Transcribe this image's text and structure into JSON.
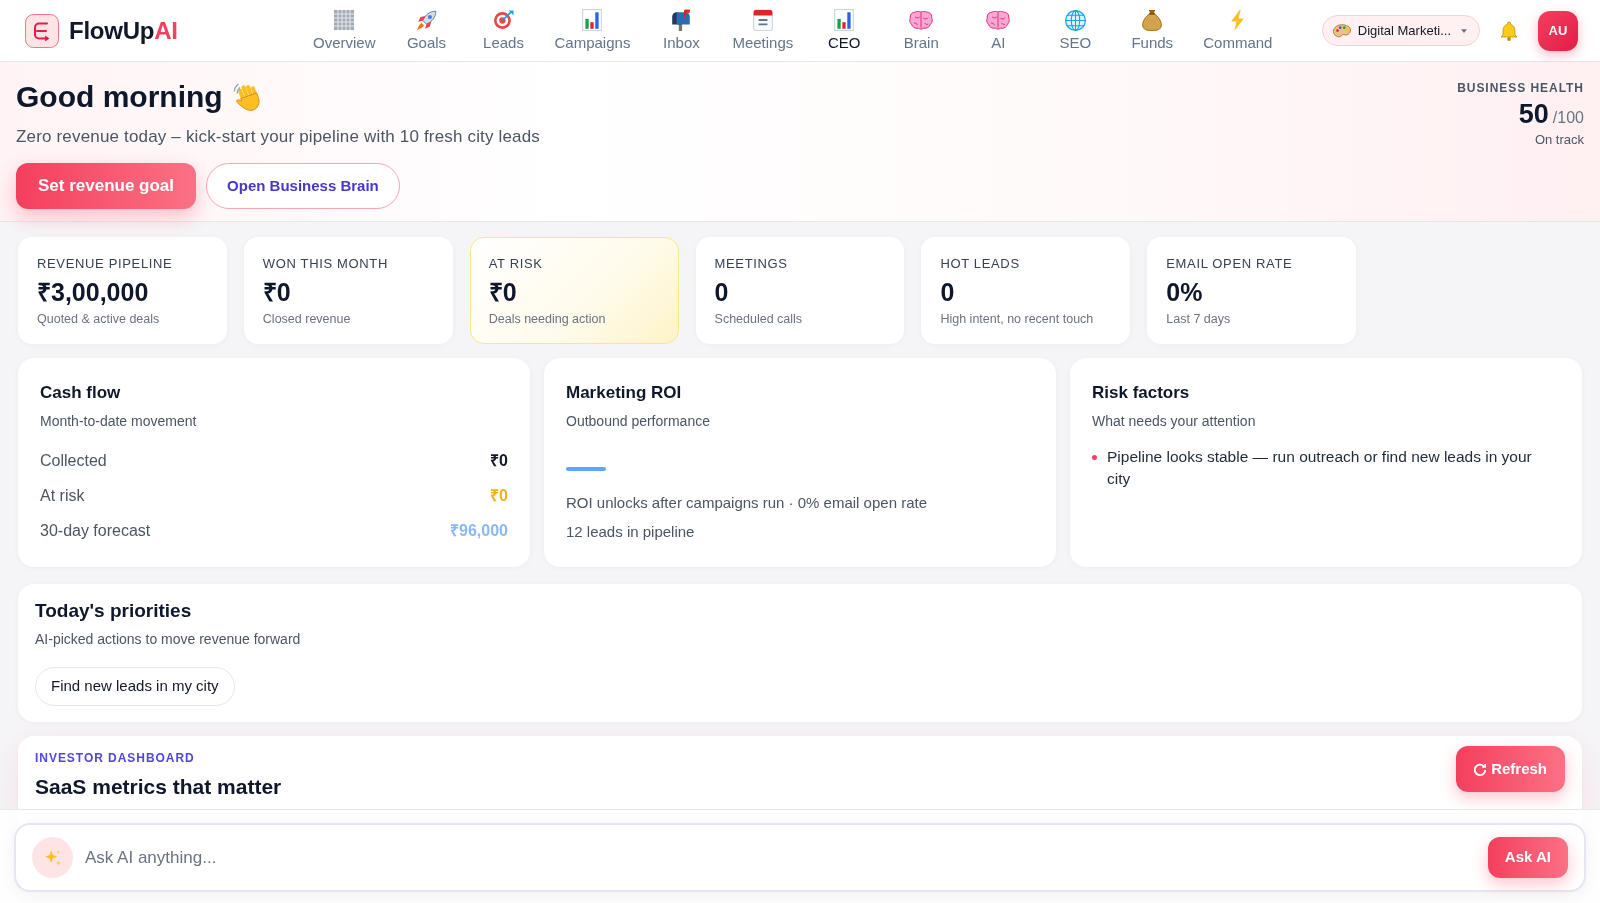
{
  "header": {
    "brand": {
      "name": "FlowUp",
      "accent": "AI"
    },
    "nav": [
      {
        "label": "Overview",
        "selected": false
      },
      {
        "label": "Goals",
        "selected": false
      },
      {
        "label": "Leads",
        "selected": false
      },
      {
        "label": "Campaigns",
        "selected": false
      },
      {
        "label": "Inbox",
        "selected": false
      },
      {
        "label": "Meetings",
        "selected": false
      },
      {
        "label": "CEO",
        "selected": true
      },
      {
        "label": "Brain",
        "selected": false
      },
      {
        "label": "AI",
        "selected": false
      },
      {
        "label": "SEO",
        "selected": false
      },
      {
        "label": "Funds",
        "selected": false
      },
      {
        "label": "Command",
        "selected": false
      }
    ],
    "workspace": {
      "label": "Digital Marketi..."
    },
    "avatar": {
      "initials": "AU"
    }
  },
  "hero": {
    "greeting": "Good morning",
    "subtitle": "Zero revenue today – kick-start your pipeline with 10 fresh city leads",
    "buttons": [
      {
        "label": "Set revenue goal",
        "kind": "primary"
      },
      {
        "label": "Open Business Brain",
        "kind": "outline"
      }
    ],
    "health": {
      "label": "BUSINESS HEALTH",
      "score": "50",
      "max": "/100",
      "status": "On track"
    }
  },
  "stats": [
    {
      "label": "REVENUE PIPELINE",
      "value": "₹3,00,000",
      "note": "Quoted & active deals",
      "highlighted": false
    },
    {
      "label": "WON THIS MONTH",
      "value": "₹0",
      "note": "Closed revenue",
      "highlighted": false
    },
    {
      "label": "AT RISK",
      "value": "₹0",
      "note": "Deals needing action",
      "highlighted": true
    },
    {
      "label": "MEETINGS",
      "value": "0",
      "note": "Scheduled calls",
      "highlighted": false
    },
    {
      "label": "HOT LEADS",
      "value": "0",
      "note": "High intent, no recent touch",
      "highlighted": false
    },
    {
      "label": "EMAIL OPEN RATE",
      "value": "0%",
      "note": "Last 7 days",
      "highlighted": false
    }
  ],
  "cash_flow": {
    "title": "Cash flow",
    "subtitle": "Month-to-date movement",
    "rows": [
      {
        "label": "Collected",
        "value": "₹0",
        "color": "#111827"
      },
      {
        "label": "At risk",
        "value": "₹0",
        "color": "#f5b014"
      },
      {
        "label": "30-day forecast",
        "value": "₹96,000",
        "color": "#8ab8f5"
      }
    ]
  },
  "marketing_roi": {
    "title": "Marketing ROI",
    "subtitle": "Outbound performance",
    "lines": [
      "ROI unlocks after campaigns run · 0% email open rate",
      "12 leads in pipeline"
    ]
  },
  "risk_factors": {
    "title": "Risk factors",
    "subtitle": "What needs your attention",
    "items": [
      "Pipeline looks stable — run outreach or find new leads in your city"
    ]
  },
  "priorities": {
    "title": "Today's priorities",
    "subtitle": "AI-picked actions to move revenue forward",
    "actions": [
      "Find new leads in my city"
    ]
  },
  "investor": {
    "eyebrow": "INVESTOR DASHBOARD",
    "title": "SaaS metrics that matter",
    "button": "Refresh"
  },
  "ask_bar": {
    "placeholder": "Ask AI anything...",
    "button": "Ask AI"
  }
}
